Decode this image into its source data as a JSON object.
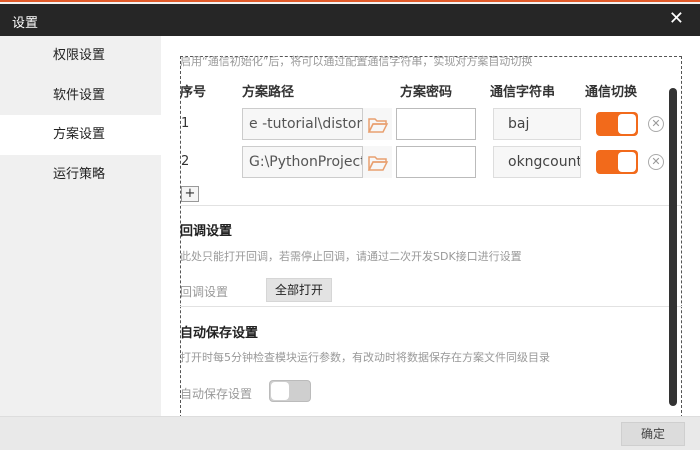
{
  "window": {
    "title": "设置"
  },
  "sidebar": {
    "items": [
      {
        "label": "权限设置",
        "active": false
      },
      {
        "label": "软件设置",
        "active": false
      },
      {
        "label": "方案设置",
        "active": true
      },
      {
        "label": "运行策略",
        "active": false
      }
    ]
  },
  "scheme": {
    "hint": "启用“通信初始化”后，将可以通过配置通信字符串，实现对方案自动切换",
    "headers": {
      "index": "序号",
      "path": "方案路径",
      "password": "方案密码",
      "comm_string": "通信字符串",
      "comm_switch": "通信切换"
    },
    "rows": [
      {
        "index": "1",
        "path": "e -tutorial\\distortio",
        "password": "",
        "comm_string": "baj",
        "switch_on": true
      },
      {
        "index": "2",
        "path": "G:\\PythonProject\\",
        "password": "",
        "comm_string": "okngcount",
        "switch_on": true
      }
    ],
    "add_label": "+"
  },
  "callback": {
    "title": "回调设置",
    "desc": "此处只能打开回调，若需停止回调，请通过二次开发SDK接口进行设置",
    "label": "回调设置",
    "button": "全部打开"
  },
  "autosave": {
    "title": "自动保存设置",
    "desc": "打开时每5分钟检查模块运行参数，有改动时将数据保存在方案文件同级目录",
    "label": "自动保存设置",
    "switch_on": false
  },
  "footer": {
    "ok_label": "确定"
  },
  "colors": {
    "accent": "#f26a1b",
    "titlebar": "#262626"
  }
}
